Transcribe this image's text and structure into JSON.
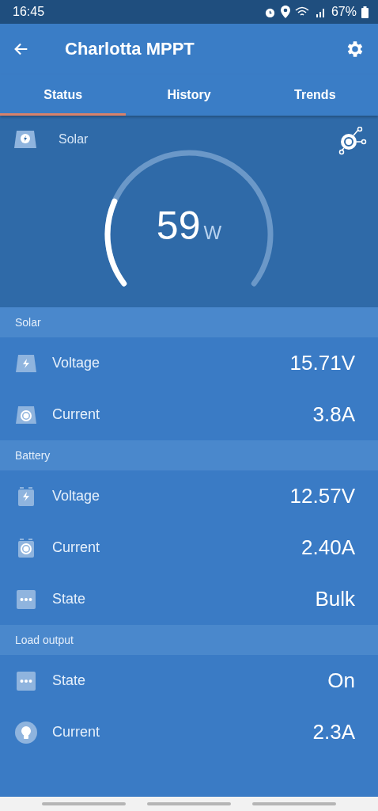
{
  "status_bar": {
    "time": "16:45",
    "battery": "67%"
  },
  "header": {
    "title": "Charlotta MPPT"
  },
  "tabs": [
    {
      "label": "Status",
      "selected": true
    },
    {
      "label": "History",
      "selected": false
    },
    {
      "label": "Trends",
      "selected": false
    }
  ],
  "gauge": {
    "label": "Solar",
    "value": "59",
    "unit": "W"
  },
  "sections": [
    {
      "title": "Solar",
      "kind": "solar",
      "rows": [
        {
          "kind": "voltage",
          "label": "Voltage",
          "value": "15.71V"
        },
        {
          "kind": "current",
          "label": "Current",
          "value": "3.8A"
        }
      ]
    },
    {
      "title": "Battery",
      "kind": "battery",
      "rows": [
        {
          "kind": "voltage",
          "label": "Voltage",
          "value": "12.57V"
        },
        {
          "kind": "current",
          "label": "Current",
          "value": "2.40A"
        },
        {
          "kind": "state",
          "label": "State",
          "value": "Bulk"
        }
      ]
    },
    {
      "title": "Load output",
      "kind": "load",
      "rows": [
        {
          "kind": "state",
          "label": "State",
          "value": "On"
        },
        {
          "kind": "light",
          "label": "Current",
          "value": "2.3A"
        }
      ]
    }
  ]
}
